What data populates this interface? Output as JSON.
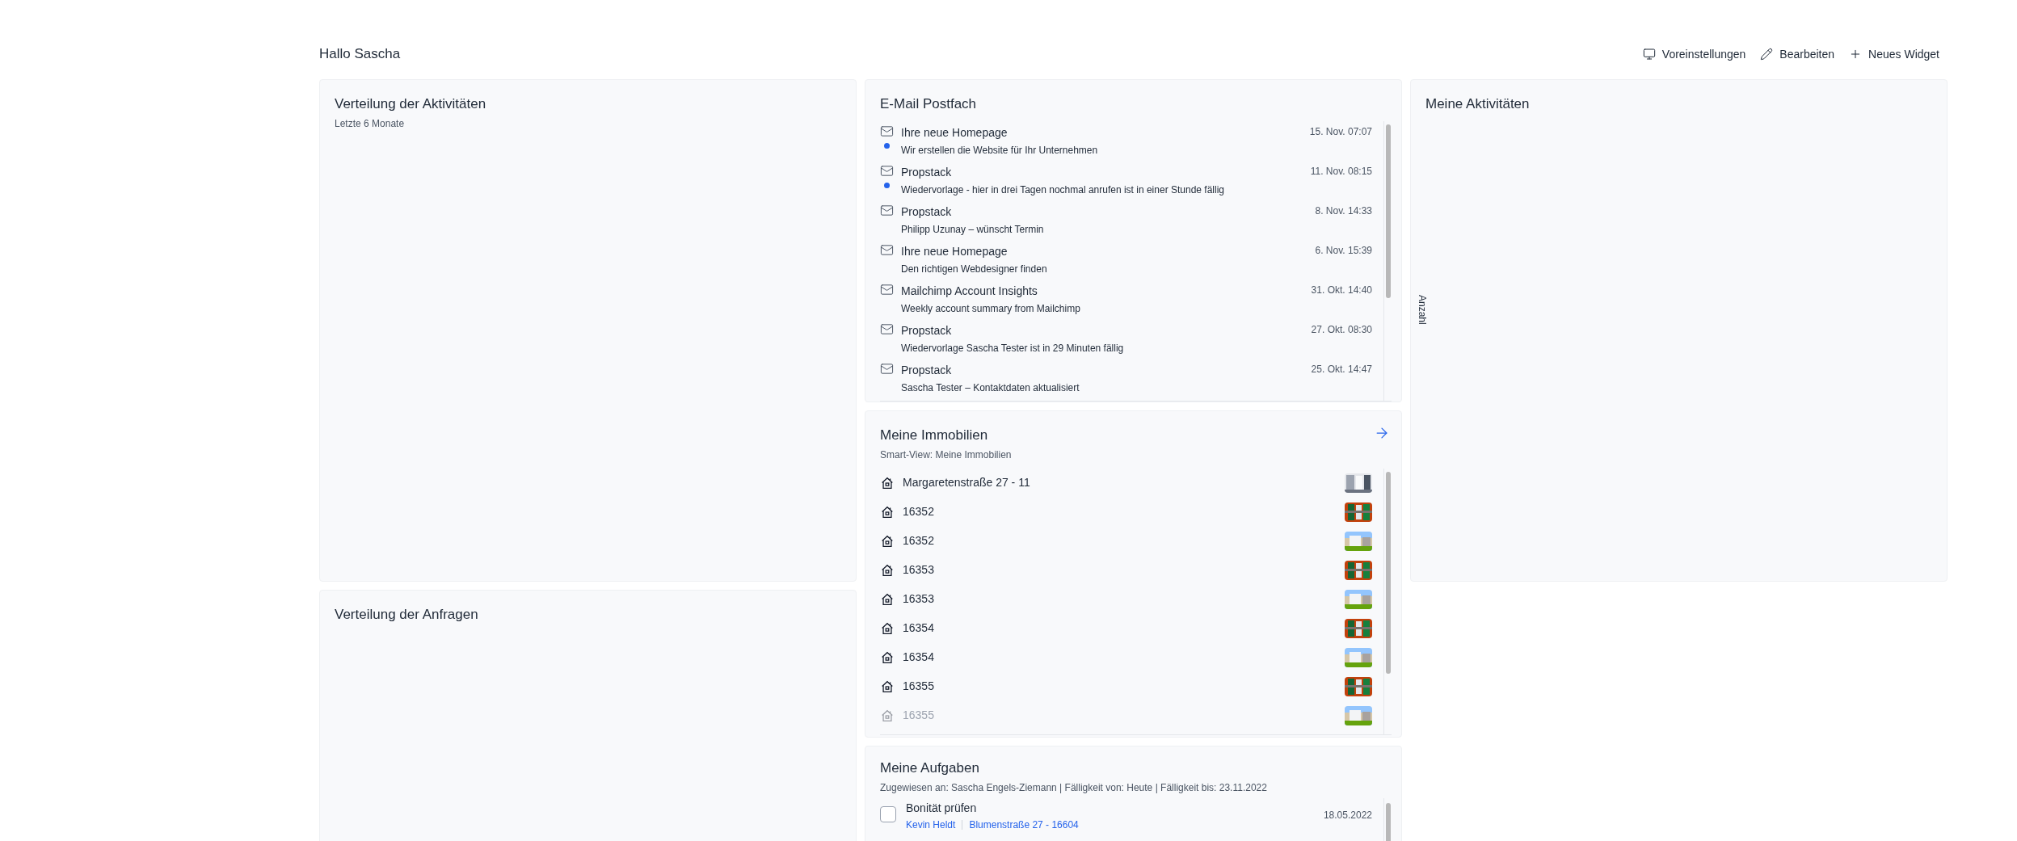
{
  "greeting": "Hallo Sascha",
  "toolbar": [
    {
      "kind": "monitor",
      "label": "Voreinstellungen"
    },
    {
      "kind": "pencil",
      "label": "Bearbeiten"
    },
    {
      "kind": "plus",
      "label": "Neues Widget"
    }
  ],
  "activity_distribution": {
    "title": "Verteilung der Aktivitäten",
    "subtitle": "Letzte 6 Monate"
  },
  "request_distribution": {
    "title": "Verteilung der Anfragen"
  },
  "mailbox": {
    "title": "E-Mail Postfach",
    "emails": [
      {
        "sender": "Ihre neue Homepage",
        "preview": "Wir erstellen die Website für Ihr Unternehmen",
        "date": "15. Nov. 07:07",
        "unread": true
      },
      {
        "sender": "Propstack",
        "preview": "Wiedervorlage - hier in drei Tagen nochmal anrufen ist in einer Stunde fällig",
        "date": "11. Nov. 08:15",
        "unread": true
      },
      {
        "sender": "Propstack",
        "preview": "Philipp Uzunay – wünscht Termin",
        "date": "8. Nov. 14:33",
        "unread": false
      },
      {
        "sender": "Ihre neue Homepage",
        "preview": "Den richtigen Webdesigner finden",
        "date": "6. Nov. 15:39",
        "unread": false
      },
      {
        "sender": "Mailchimp Account Insights",
        "preview": "Weekly account summary from Mailchimp",
        "date": "31. Okt. 14:40",
        "unread": false
      },
      {
        "sender": "Propstack",
        "preview": "Wiedervorlage Sascha Tester ist in 29 Minuten fällig",
        "date": "27. Okt. 08:30",
        "unread": false
      },
      {
        "sender": "Propstack",
        "preview": "Sascha Tester – Kontaktdaten aktualisiert",
        "date": "25. Okt. 14:47",
        "unread": false
      }
    ]
  },
  "properties": {
    "title": "Meine Immobilien",
    "subtitle": "Smart-View: Meine Immobilien",
    "items": [
      {
        "name": "Margaretenstraße 27 - 11"
      },
      {
        "name": "16352"
      },
      {
        "name": "16352"
      },
      {
        "name": "16353"
      },
      {
        "name": "16353"
      },
      {
        "name": "16354"
      },
      {
        "name": "16354"
      },
      {
        "name": "16355"
      },
      {
        "name": "16355"
      }
    ]
  },
  "tasks": {
    "title": "Meine Aufgaben",
    "subtitle": "Zugewiesen an: Sascha Engels-Ziemann | Fälligkeit von: Heute | Fälligkeit bis: 23.11.2022",
    "items": [
      {
        "title": "Bonität prüfen",
        "contact": "Kevin Heldt",
        "property": "Blumenstraße 27 - 16604",
        "date": "18.05.2022",
        "checked": false
      }
    ]
  },
  "my_activities": {
    "title": "Meine Aktivitäten",
    "axis_label": "Anzahl"
  }
}
